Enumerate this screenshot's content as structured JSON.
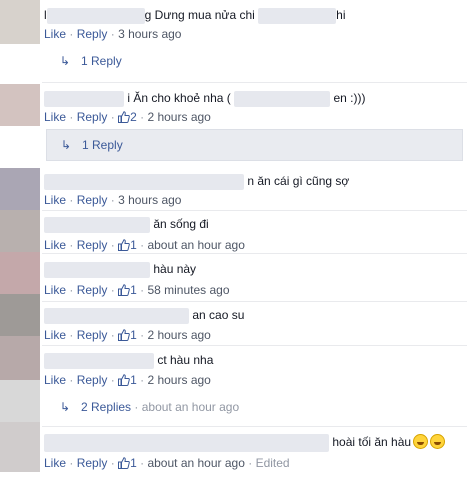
{
  "labels": {
    "like": "Like",
    "reply": "Reply",
    "edited": "Edited",
    "sep": "·"
  },
  "comments": [
    {
      "text_pre": "l",
      "text": "g Dưng mua nửa chi",
      "text_post": "hi",
      "time": "3 hours ago",
      "likes": ""
    },
    {
      "text": "i Ăn cho khoẻ nha (",
      "text_post": "en :)))",
      "time": "2 hours ago",
      "likes": "2"
    },
    {
      "text": "n ăn cái gì cũng sợ",
      "time": "3 hours ago",
      "likes": ""
    },
    {
      "text": "ăn sống đi",
      "time": "about an hour ago",
      "likes": "1"
    },
    {
      "text": "hàu này",
      "time": "58 minutes ago",
      "likes": "1"
    },
    {
      "text": "an cao su",
      "time": "2 hours ago",
      "likes": "1"
    },
    {
      "text": "ct hàu nha",
      "time": "2 hours ago",
      "likes": "1"
    },
    {
      "text": "hoài tối ăn hàu",
      "time": "about an hour ago",
      "likes": "1"
    }
  ],
  "reply_rows": [
    {
      "label": "1 Reply",
      "time": ""
    },
    {
      "label": "1 Reply",
      "time": ""
    },
    {
      "label": "2 Replies",
      "time": "about an hour ago"
    }
  ],
  "emoji_names": [
    "laughing-emoji",
    "laughing-emoji"
  ]
}
